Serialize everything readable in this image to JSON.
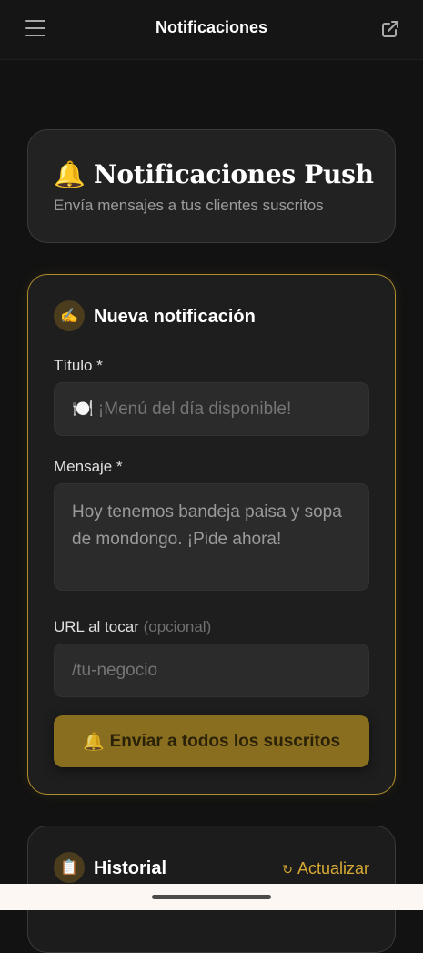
{
  "header": {
    "title": "Notificaciones",
    "menu_icon": "hamburger-menu-icon",
    "external_icon": "external-link-icon"
  },
  "hero": {
    "icon": "🔔",
    "title": "Notificaciones Push",
    "subtitle": "Envía mensajes a tus clientes suscritos"
  },
  "form": {
    "section_icon": "✍️",
    "section_title": "Nueva notificación",
    "title_label": "Título *",
    "title_placeholder": "🍽️ ¡Menú del día disponible!",
    "message_label": "Mensaje *",
    "message_placeholder": "Hoy tenemos bandeja paisa y sopa de mondongo. ¡Pide ahora!",
    "url_label": "URL al tocar",
    "url_optional": "(opcional)",
    "url_placeholder": "/tu-negocio",
    "send_icon": "🔔",
    "send_label": "Enviar a todos los suscritos"
  },
  "history": {
    "icon": "📋",
    "title": "Historial",
    "refresh_icon": "↻",
    "refresh_label": "Actualizar"
  },
  "colors": {
    "accent": "#d6a834",
    "button": "#8a6e1f",
    "background": "#121212",
    "card": "#1e1e1e"
  }
}
